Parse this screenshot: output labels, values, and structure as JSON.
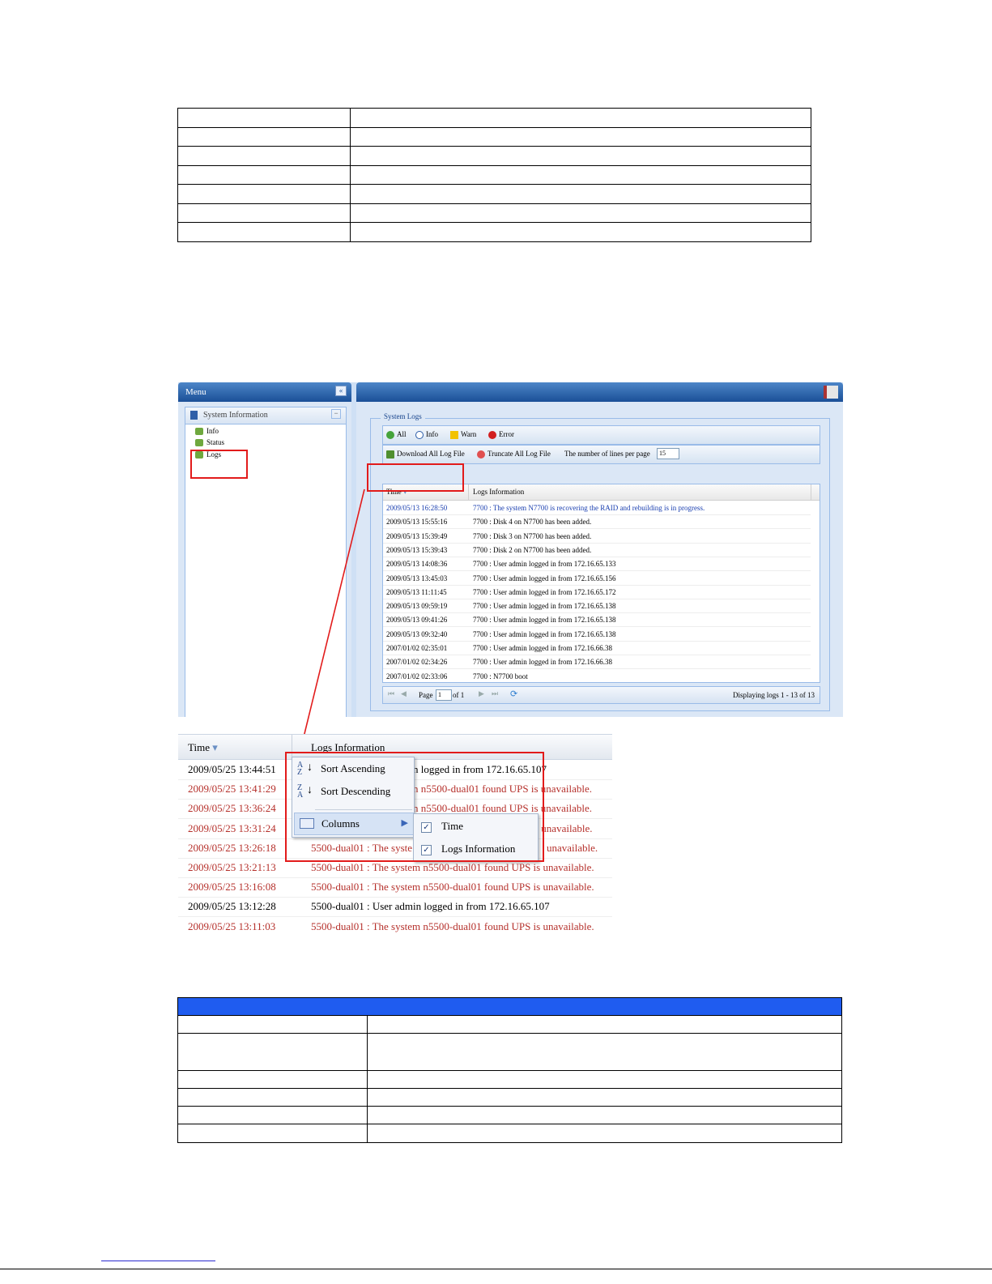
{
  "top_table": {
    "rows": 7
  },
  "window": {
    "menu": {
      "title": "Menu",
      "collapse_glyph": "«",
      "section": "System Information",
      "section_toggle": "−",
      "items": [
        "Info",
        "Status",
        "Logs"
      ]
    },
    "exit_icon": "logout-icon",
    "panel": {
      "legend": "System Logs",
      "filters": [
        "All",
        "Info",
        "Warn",
        "Error"
      ],
      "download_label": "Download All Log File",
      "truncate_label": "Truncate All Log File",
      "lines_label": "The number of lines per page",
      "lines_value": "15",
      "columns": [
        "Time",
        "Logs Information"
      ],
      "logs": [
        {
          "time": "2009/05/13 16:28:50",
          "info": "7700 : The system N7700 is recovering the RAID and rebuilding is in progress.",
          "level": "info"
        },
        {
          "time": "2009/05/13 15:55:16",
          "info": "7700 : Disk 4 on N7700 has been added.",
          "level": "normal"
        },
        {
          "time": "2009/05/13 15:39:49",
          "info": "7700 : Disk 3 on N7700 has been added.",
          "level": "normal"
        },
        {
          "time": "2009/05/13 15:39:43",
          "info": "7700 : Disk 2 on N7700 has been added.",
          "level": "normal"
        },
        {
          "time": "2009/05/13 14:08:36",
          "info": "7700 : User admin logged in from 172.16.65.133",
          "level": "normal"
        },
        {
          "time": "2009/05/13 13:45:03",
          "info": "7700 : User admin logged in from 172.16.65.156",
          "level": "normal"
        },
        {
          "time": "2009/05/13 11:11:45",
          "info": "7700 : User admin logged in from 172.16.65.172",
          "level": "normal"
        },
        {
          "time": "2009/05/13 09:59:19",
          "info": "7700 : User admin logged in from 172.16.65.138",
          "level": "normal"
        },
        {
          "time": "2009/05/13 09:41:26",
          "info": "7700 : User admin logged in from 172.16.65.138",
          "level": "normal"
        },
        {
          "time": "2009/05/13 09:32:40",
          "info": "7700 : User admin logged in from 172.16.65.138",
          "level": "normal"
        },
        {
          "time": "2007/01/02 02:35:01",
          "info": "7700 : User admin logged in from 172.16.66.38",
          "level": "normal"
        },
        {
          "time": "2007/01/02 02:34:26",
          "info": "7700 : User admin logged in from 172.16.66.38",
          "level": "normal"
        },
        {
          "time": "2007/01/02 02:33:06",
          "info": "7700 : N7700 boot",
          "level": "normal"
        }
      ],
      "pager": {
        "page_label": "Page",
        "page_value": "1",
        "of_label": "of 1",
        "display_text": "Displaying logs 1 - 13 of 13"
      }
    }
  },
  "zoom": {
    "columns": [
      "Time",
      "Logs Information"
    ],
    "rows": [
      {
        "time": "2009/05/25 13:44:51",
        "info": "n logged in from 172.16.65.107",
        "level": "normal"
      },
      {
        "time": "2009/05/25 13:41:29",
        "info": "n n5500-dual01 found UPS is unavailable.",
        "level": "error"
      },
      {
        "time": "2009/05/25 13:36:24",
        "info": "n n5500-dual01 found UPS is unavailable.",
        "level": "error"
      },
      {
        "time": "2009/05/25 13:31:24",
        "info": "s unavailable.",
        "level": "error"
      },
      {
        "time": "2009/05/25 13:26:18",
        "info": "5500-dual01 : The syste",
        "info_tail": "unavailable.",
        "level": "error"
      },
      {
        "time": "2009/05/25 13:21:13",
        "info": "5500-dual01 : The system n5500-dual01 found UPS is unavailable.",
        "level": "error"
      },
      {
        "time": "2009/05/25 13:16:08",
        "info": "5500-dual01 : The system n5500-dual01 found UPS is unavailable.",
        "level": "error"
      },
      {
        "time": "2009/05/25 13:12:28",
        "info": "5500-dual01 : User admin logged in from 172.16.65.107",
        "level": "normal"
      },
      {
        "time": "2009/05/25 13:11:03",
        "info": "5500-dual01 : The system n5500-dual01 found UPS is unavailable.",
        "level": "error"
      }
    ],
    "menu": {
      "sort_asc": "Sort Ascending",
      "sort_desc": "Sort Descending",
      "columns": "Columns",
      "column_options": [
        {
          "label": "Time",
          "checked": true
        },
        {
          "label": "Logs Information",
          "checked": true
        }
      ]
    }
  },
  "bottom_table": {
    "header_color": "#1f5cf0",
    "rows": 6
  },
  "colors": {
    "annotation_red": "#e21b1b",
    "info_blue": "#1a3fb0",
    "error_red": "#b5302b"
  }
}
